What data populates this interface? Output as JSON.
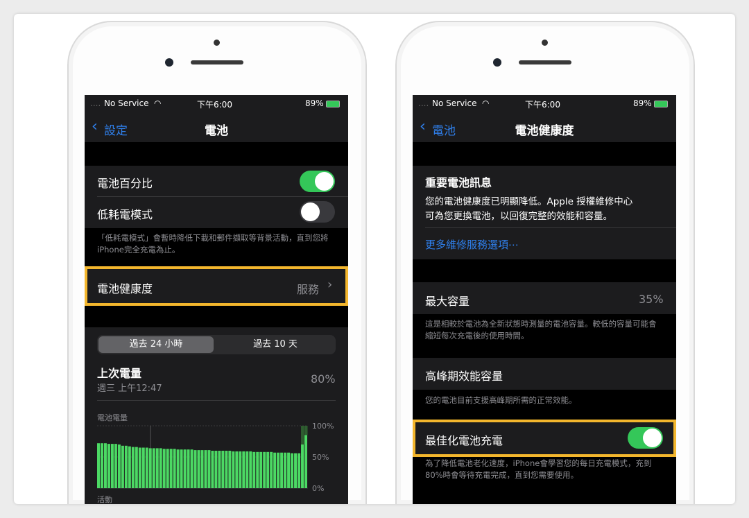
{
  "colors": {
    "accent": "#2f80ed",
    "toggle_on": "#34c759",
    "highlight": "#f3b62d",
    "chart_bar": "#4cd964"
  },
  "left": {
    "status": {
      "carrier": "No Service",
      "time": "下午6:00",
      "battery": "89%"
    },
    "nav": {
      "back": "設定",
      "title": "電池"
    },
    "battery_percentage": {
      "label": "電池百分比",
      "on": true
    },
    "low_power": {
      "label": "低耗電模式",
      "on": false
    },
    "low_power_footer": "「低耗電模式」會暫時降低下載和郵件擷取等背景活動，直到您將iPhone完全充電為止。",
    "battery_health": {
      "label": "電池健康度",
      "value": "服務"
    },
    "segments": [
      "過去 24 小時",
      "過去 10 天"
    ],
    "selected_segment": 0,
    "last_charge": {
      "label": "上次電量",
      "time": "週三 上午12:47",
      "value": "80%"
    },
    "chart_title": "電池電量",
    "next_section": "活動",
    "chart_data": {
      "type": "bar",
      "ylabel": "電池電量",
      "yticks": [
        "100%",
        "50%",
        "0%"
      ],
      "ylim": [
        0,
        100
      ],
      "values": [
        72,
        72,
        72,
        71,
        71,
        71,
        70,
        68,
        68,
        67,
        66,
        66,
        65,
        65,
        65,
        64,
        64,
        64,
        64,
        63,
        63,
        63,
        63,
        62,
        62,
        62,
        62,
        62,
        61,
        61,
        61,
        61,
        61,
        60,
        60,
        60,
        60,
        60,
        60,
        59,
        59,
        59,
        59,
        59,
        59,
        58,
        58,
        58,
        58,
        58,
        58,
        57,
        57,
        57,
        57,
        57,
        56,
        56,
        56,
        70,
        85
      ],
      "charging_to": 100
    }
  },
  "right": {
    "status": {
      "carrier": "No Service",
      "time": "下午6:00",
      "battery": "89%"
    },
    "nav": {
      "back": "電池",
      "title": "電池健康度"
    },
    "important": {
      "title": "重要電池訊息",
      "text1": "您的電池健康度已明顯降低。Apple 授權維修中心",
      "text2": "可為您更換電池，以回復完整的效能和容量。",
      "link": "更多維修服務選項⋯"
    },
    "max_capacity": {
      "label": "最大容量",
      "value": "35%",
      "footer": "這是相較於電池為全新狀態時測量的電池容量。較低的容量可能會縮短每次充電後的使用時間。"
    },
    "peak": {
      "label": "高峰期效能容量",
      "footer": "您的電池目前支援高峰期所需的正常效能。"
    },
    "optimized": {
      "label": "最佳化電池充電",
      "on": true,
      "footer": "為了降低電池老化速度，iPhone會學習您的每日充電模式，充到80%時會等待充電完成，直到您需要使用。"
    }
  }
}
